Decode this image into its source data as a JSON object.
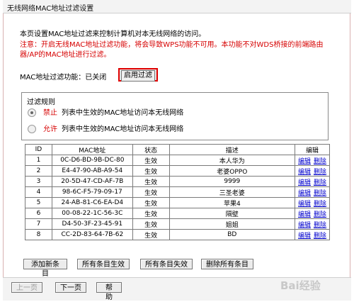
{
  "page": {
    "title": "无线网络MAC地址过滤设置"
  },
  "intro": {
    "description": "本页设置MAC地址过滤来控制计算机对本无线网络的访问。",
    "warning_line1": "注意：开启无线MAC地址过滤功能，将会导致WPS功能不可用。本功能不对WDS桥接的前端路由",
    "warning_line2": "器/AP的MAC地址进行过滤。"
  },
  "filter_status": {
    "label": "MAC地址过滤功能：",
    "value": "已关闭",
    "enable_button": "启用过滤"
  },
  "rules": {
    "title": "过滤规则",
    "options": [
      {
        "keyword": "禁止",
        "text": "列表中生效的MAC地址访问本无线网络",
        "selected": true
      },
      {
        "keyword": "允许",
        "text": "列表中生效的MAC地址访问本无线网络",
        "selected": false
      }
    ]
  },
  "table": {
    "headers": [
      "ID",
      "MAC地址",
      "状态",
      "描述",
      "编辑"
    ],
    "edit_label": "编辑",
    "delete_label": "删除",
    "rows": [
      {
        "id": "1",
        "mac": "0C-D6-BD-9B-DC-80",
        "status": "生效",
        "desc": "本人华为"
      },
      {
        "id": "2",
        "mac": "E4-47-90-AB-A9-54",
        "status": "生效",
        "desc": "老婆OPPO"
      },
      {
        "id": "3",
        "mac": "20-5D-47-CD-AF-7B",
        "status": "生效",
        "desc": "9999"
      },
      {
        "id": "4",
        "mac": "98-6C-F5-79-09-17",
        "status": "生效",
        "desc": "三圣老婆"
      },
      {
        "id": "5",
        "mac": "24-AB-81-C6-EA-D4",
        "status": "生效",
        "desc": "苹果4"
      },
      {
        "id": "6",
        "mac": "00-08-22-1C-56-3C",
        "status": "生效",
        "desc": "隔壁"
      },
      {
        "id": "7",
        "mac": "D4-50-3F-23-45-91",
        "status": "生效",
        "desc": "姐姐"
      },
      {
        "id": "8",
        "mac": "CC-2D-83-64-7B-62",
        "status": "生效",
        "desc": "BD"
      }
    ]
  },
  "actions": {
    "add": "添加新条目",
    "enable_all": "所有条目生效",
    "disable_all": "所有条目失效",
    "delete_all": "删除所有条目"
  },
  "nav": {
    "prev": "上一页",
    "next": "下一页",
    "help": "帮 助"
  },
  "watermark": "Bai经验"
}
